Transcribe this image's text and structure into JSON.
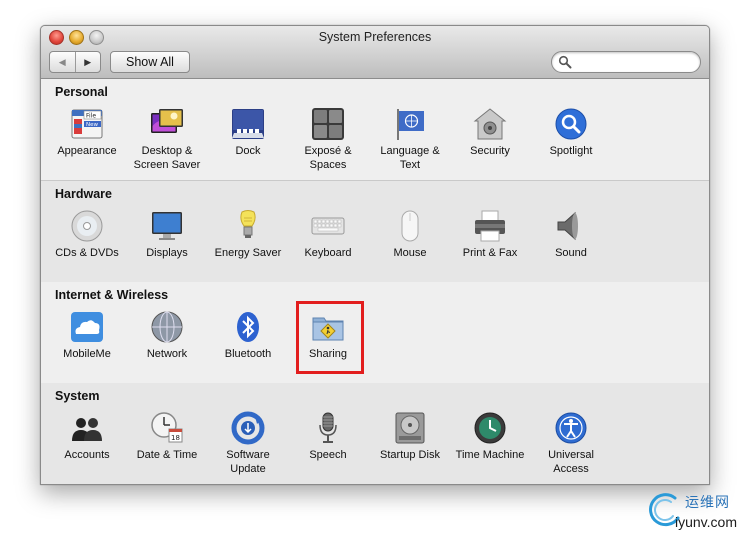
{
  "window": {
    "title": "System Preferences",
    "show_all_label": "Show All",
    "nav_back_glyph": "◀",
    "nav_forward_glyph": "▶",
    "search": {
      "value": "",
      "placeholder": ""
    }
  },
  "sections": [
    {
      "title": "Personal",
      "items": [
        {
          "label": "Appearance",
          "icon": "appearance-icon"
        },
        {
          "label": "Desktop & Screen Saver",
          "icon": "desktop-screen-saver-icon"
        },
        {
          "label": "Dock",
          "icon": "dock-icon"
        },
        {
          "label": "Exposé & Spaces",
          "icon": "expose-spaces-icon"
        },
        {
          "label": "Language & Text",
          "icon": "language-text-icon"
        },
        {
          "label": "Security",
          "icon": "security-icon"
        },
        {
          "label": "Spotlight",
          "icon": "spotlight-icon"
        }
      ]
    },
    {
      "title": "Hardware",
      "items": [
        {
          "label": "CDs & DVDs",
          "icon": "cds-dvds-icon"
        },
        {
          "label": "Displays",
          "icon": "displays-icon"
        },
        {
          "label": "Energy Saver",
          "icon": "energy-saver-icon"
        },
        {
          "label": "Keyboard",
          "icon": "keyboard-icon"
        },
        {
          "label": "Mouse",
          "icon": "mouse-icon"
        },
        {
          "label": "Print & Fax",
          "icon": "print-fax-icon"
        },
        {
          "label": "Sound",
          "icon": "sound-icon"
        }
      ]
    },
    {
      "title": "Internet & Wireless",
      "items": [
        {
          "label": "MobileMe",
          "icon": "mobileme-icon"
        },
        {
          "label": "Network",
          "icon": "network-icon"
        },
        {
          "label": "Bluetooth",
          "icon": "bluetooth-icon"
        },
        {
          "label": "Sharing",
          "icon": "sharing-icon"
        }
      ]
    },
    {
      "title": "System",
      "items": [
        {
          "label": "Accounts",
          "icon": "accounts-icon"
        },
        {
          "label": "Date & Time",
          "icon": "date-time-icon"
        },
        {
          "label": "Software Update",
          "icon": "software-update-icon"
        },
        {
          "label": "Speech",
          "icon": "speech-icon"
        },
        {
          "label": "Startup Disk",
          "icon": "startup-disk-icon"
        },
        {
          "label": "Time Machine",
          "icon": "time-machine-icon"
        },
        {
          "label": "Universal Access",
          "icon": "universal-access-icon"
        }
      ]
    }
  ],
  "highlight": {
    "target": "Sharing",
    "color": "#e21d1d"
  },
  "watermark": {
    "chinese": "运维网",
    "url": "iyunv.com"
  },
  "colors": {
    "accent_blue": "#2a73b8",
    "window_bg": "#e8e8e8"
  }
}
